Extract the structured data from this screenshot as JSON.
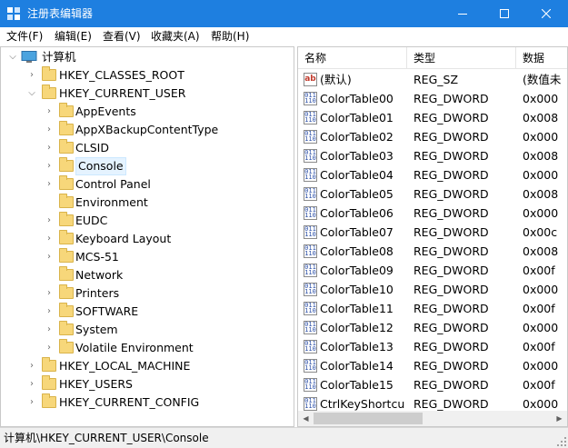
{
  "window": {
    "title": "注册表编辑器",
    "colors": {
      "titlebar": "#1e7fe0",
      "selection": "#e5f3ff",
      "folder": "#f7d77a"
    }
  },
  "menu": [
    "文件(F)",
    "编辑(E)",
    "查看(V)",
    "收藏夹(A)",
    "帮助(H)"
  ],
  "tree": {
    "root": "计算机",
    "hives": {
      "classes_root": "HKEY_CLASSES_ROOT",
      "current_user": "HKEY_CURRENT_USER",
      "local_machine": "HKEY_LOCAL_MACHINE",
      "users": "HKEY_USERS",
      "current_config": "HKEY_CURRENT_CONFIG"
    },
    "current_user_children": [
      {
        "label": "AppEvents",
        "expandable": true
      },
      {
        "label": "AppXBackupContentType",
        "expandable": true
      },
      {
        "label": "CLSID",
        "expandable": true
      },
      {
        "label": "Console",
        "expandable": true,
        "selected": true
      },
      {
        "label": "Control Panel",
        "expandable": true
      },
      {
        "label": "Environment",
        "expandable": false
      },
      {
        "label": "EUDC",
        "expandable": true
      },
      {
        "label": "Keyboard Layout",
        "expandable": true
      },
      {
        "label": "MCS-51",
        "expandable": true
      },
      {
        "label": "Network",
        "expandable": false
      },
      {
        "label": "Printers",
        "expandable": true
      },
      {
        "label": "SOFTWARE",
        "expandable": true
      },
      {
        "label": "System",
        "expandable": true
      },
      {
        "label": "Volatile Environment",
        "expandable": true
      }
    ]
  },
  "list": {
    "columns": {
      "name": "名称",
      "type": "类型",
      "data": "数据"
    },
    "rows": [
      {
        "icon": "string-value-icon",
        "name": "(默认)",
        "type": "REG_SZ",
        "data": "(数值未"
      },
      {
        "icon": "binary-value-icon",
        "name": "ColorTable00",
        "type": "REG_DWORD",
        "data": "0x000"
      },
      {
        "icon": "binary-value-icon",
        "name": "ColorTable01",
        "type": "REG_DWORD",
        "data": "0x008"
      },
      {
        "icon": "binary-value-icon",
        "name": "ColorTable02",
        "type": "REG_DWORD",
        "data": "0x000"
      },
      {
        "icon": "binary-value-icon",
        "name": "ColorTable03",
        "type": "REG_DWORD",
        "data": "0x008"
      },
      {
        "icon": "binary-value-icon",
        "name": "ColorTable04",
        "type": "REG_DWORD",
        "data": "0x000"
      },
      {
        "icon": "binary-value-icon",
        "name": "ColorTable05",
        "type": "REG_DWORD",
        "data": "0x008"
      },
      {
        "icon": "binary-value-icon",
        "name": "ColorTable06",
        "type": "REG_DWORD",
        "data": "0x000"
      },
      {
        "icon": "binary-value-icon",
        "name": "ColorTable07",
        "type": "REG_DWORD",
        "data": "0x00c"
      },
      {
        "icon": "binary-value-icon",
        "name": "ColorTable08",
        "type": "REG_DWORD",
        "data": "0x008"
      },
      {
        "icon": "binary-value-icon",
        "name": "ColorTable09",
        "type": "REG_DWORD",
        "data": "0x00f"
      },
      {
        "icon": "binary-value-icon",
        "name": "ColorTable10",
        "type": "REG_DWORD",
        "data": "0x000"
      },
      {
        "icon": "binary-value-icon",
        "name": "ColorTable11",
        "type": "REG_DWORD",
        "data": "0x00f"
      },
      {
        "icon": "binary-value-icon",
        "name": "ColorTable12",
        "type": "REG_DWORD",
        "data": "0x000"
      },
      {
        "icon": "binary-value-icon",
        "name": "ColorTable13",
        "type": "REG_DWORD",
        "data": "0x00f"
      },
      {
        "icon": "binary-value-icon",
        "name": "ColorTable14",
        "type": "REG_DWORD",
        "data": "0x000"
      },
      {
        "icon": "binary-value-icon",
        "name": "ColorTable15",
        "type": "REG_DWORD",
        "data": "0x00f"
      },
      {
        "icon": "binary-value-icon",
        "name": "CtrlKeyShortcu...",
        "type": "REG_DWORD",
        "data": "0x000"
      }
    ]
  },
  "status": {
    "path": "计算机\\HKEY_CURRENT_USER\\Console"
  }
}
